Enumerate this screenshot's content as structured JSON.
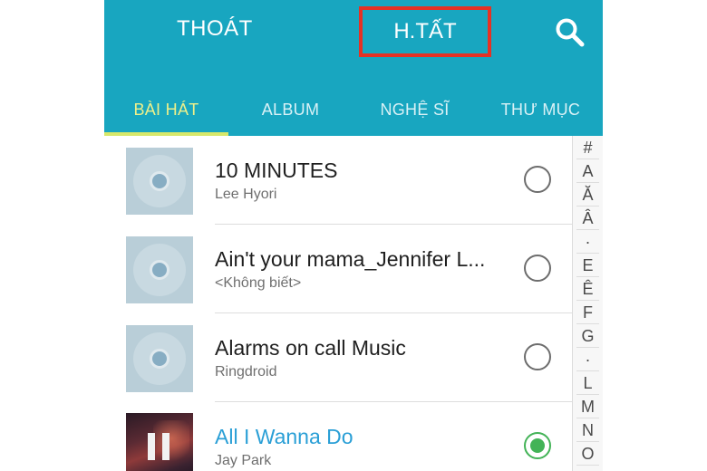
{
  "header": {
    "exit_label": "THOÁT",
    "done_label": "H.TẤT",
    "search_icon": "search-icon",
    "highlight_color": "#e53124",
    "bar_color": "#18a6c0"
  },
  "tabs": [
    {
      "label": "BÀI HÁT",
      "active": true
    },
    {
      "label": "ALBUM",
      "active": false
    },
    {
      "label": "NGHỆ SĨ",
      "active": false
    },
    {
      "label": "THƯ MỤC",
      "active": false
    }
  ],
  "songs": [
    {
      "title": "10 MINUTES",
      "artist": "Lee Hyori",
      "selected": false,
      "playing": false
    },
    {
      "title": "Ain't your mama_Jennifer L...",
      "artist": "<Không biết>",
      "selected": false,
      "playing": false
    },
    {
      "title": "Alarms on call Music",
      "artist": "Ringdroid",
      "selected": false,
      "playing": false
    },
    {
      "title": "All I Wanna Do",
      "artist": "Jay Park",
      "selected": true,
      "playing": true
    }
  ],
  "index_letters": [
    "#",
    "A",
    "Ă",
    "Â",
    "·",
    "E",
    "Ê",
    "F",
    "G",
    "·",
    "L",
    "M",
    "N",
    "O"
  ]
}
